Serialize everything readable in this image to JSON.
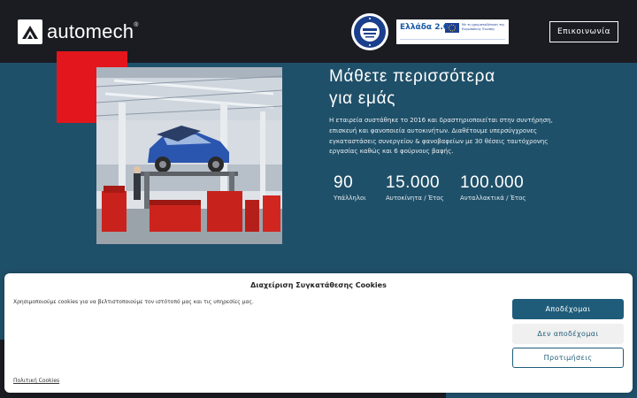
{
  "header": {
    "logo_text": "automech",
    "logo_registered": "®",
    "contact_label": "Επικοινωνία",
    "banner": {
      "brand": "Ελλάδα 2.0",
      "eu_text": "Με τη χρηματοδότηση της Ευρωπαϊκής Ένωσης"
    }
  },
  "about": {
    "title_line1": "Μάθετε περισσότερα",
    "title_line2": "για εμάς",
    "paragraph": "Η εταιρεία συστάθηκε το  2016 και δραστηριοποιείται στην συντήρηση, επισκευή  και φανοποιεία αυτοκινήτων. Διαθέτουμε υπερσύγχρονες εγκαταστάσεις συνεργείου & φανοβαφείων με 30 θέσεις ταυτόχρονης εργασίας καθώς και 6 φούρνους βαφής.",
    "stats": [
      {
        "value": "90",
        "label": "Υπάλληλοι"
      },
      {
        "value": "15.000",
        "label": "Αυτοκίνητα / Έτος"
      },
      {
        "value": "100.000",
        "label": "Ανταλλακτικά / Έτος"
      }
    ]
  },
  "cookie": {
    "title": "Διαχείριση Συγκατάθεσης Cookies",
    "message": "Χρησιμοποιούμε cookies για να βελτιστοποιούμε τον ιστότοπό μας και τις υπηρεσίες μας.",
    "accept_label": "Αποδέχομαι",
    "deny_label": "Δεν αποδέχομαι",
    "preferences_label": "Προτιμήσεις",
    "policy_link": "Πολιτική Cookies"
  },
  "colors": {
    "header_bg": "#1b1c22",
    "section_bg": "#1f5069",
    "accent_red": "#e2161c",
    "button_blue": "#1f5c7a"
  },
  "icons": {
    "logo": "automech-logo-icon",
    "certification": "certification-badge-icon",
    "eu_flag": "eu-flag-icon"
  }
}
